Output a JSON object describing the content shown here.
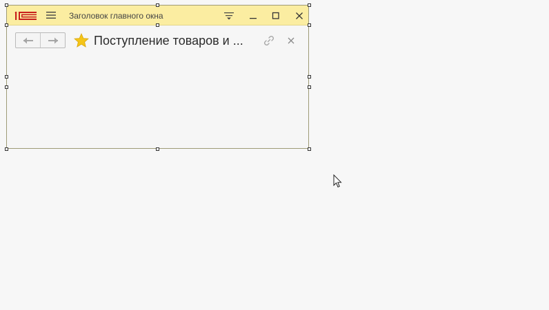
{
  "window": {
    "title": "Заголовок главного окна",
    "titlebar_color": "#fbeda1",
    "logo": "1c-logo",
    "buttons": [
      "menu-icon",
      "filter-icon",
      "minimize-icon",
      "maximize-icon",
      "close-icon"
    ]
  },
  "form": {
    "title": "Поступление товаров и ...",
    "nav": [
      "back-arrow-icon",
      "forward-arrow-icon"
    ],
    "favorite_icon": "star-icon",
    "star_color": "#f5c518",
    "link_icon": "link-icon",
    "close_icon": "close-icon"
  },
  "colors": {
    "logo_red": "#c8201c",
    "frame": "#9e9a76",
    "background": "#f7f7f7"
  }
}
